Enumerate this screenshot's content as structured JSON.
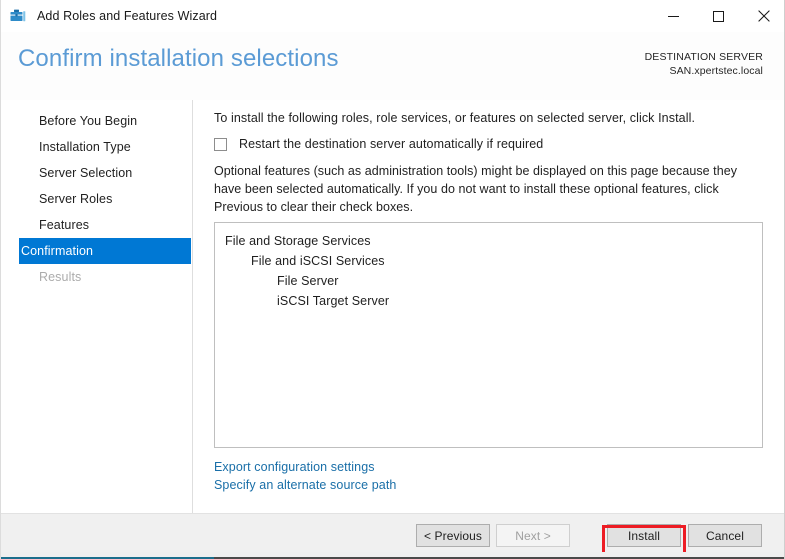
{
  "window": {
    "title": "Add Roles and Features Wizard",
    "icon": "server-manager-icon",
    "controls": {
      "minimize": "minimize-icon",
      "maximize": "maximize-icon",
      "close": "close-icon"
    }
  },
  "header": {
    "page_title": "Confirm installation selections",
    "destination_label": "DESTINATION SERVER",
    "destination_value": "SAN.xpertstec.local"
  },
  "sidebar": {
    "items": [
      {
        "label": "Before You Begin",
        "state": "normal"
      },
      {
        "label": "Installation Type",
        "state": "normal"
      },
      {
        "label": "Server Selection",
        "state": "normal"
      },
      {
        "label": "Server Roles",
        "state": "normal"
      },
      {
        "label": "Features",
        "state": "normal"
      },
      {
        "label": "Confirmation",
        "state": "selected"
      },
      {
        "label": "Results",
        "state": "disabled"
      }
    ]
  },
  "main": {
    "intro_text": "To install the following roles, role services, or features on selected server, click Install.",
    "restart_checkbox": {
      "label": "Restart the destination server automatically if required",
      "checked": false
    },
    "optional_text": "Optional features (such as administration tools) might be displayed on this page because they have been selected automatically. If you do not want to install these optional features, click Previous to clear their check boxes.",
    "selections": [
      {
        "label": "File and Storage Services",
        "level": 0
      },
      {
        "label": "File and iSCSI Services",
        "level": 1
      },
      {
        "label": "File Server",
        "level": 2
      },
      {
        "label": "iSCSI Target Server",
        "level": 2
      }
    ],
    "links": [
      {
        "label": "Export configuration settings"
      },
      {
        "label": "Specify an alternate source path"
      }
    ]
  },
  "footer": {
    "buttons": [
      {
        "label": "< Previous",
        "state": "enabled"
      },
      {
        "label": "Next >",
        "state": "disabled"
      },
      {
        "label": "Install",
        "state": "enabled",
        "highlighted": true
      },
      {
        "label": "Cancel",
        "state": "enabled"
      }
    ]
  },
  "colors": {
    "accent_blue": "#0078d4",
    "title_blue": "#5b9bd5",
    "link_blue": "#1a6fa8",
    "highlight_red": "#ed1c24",
    "footer_bg": "#f0f0f0"
  }
}
